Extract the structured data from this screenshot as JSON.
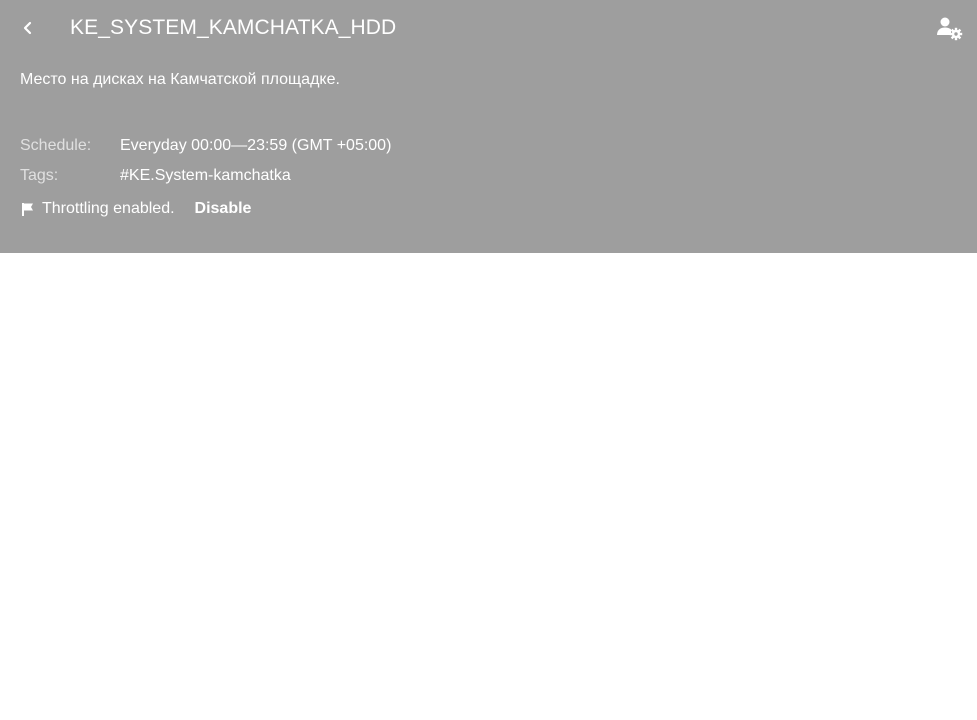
{
  "header": {
    "title": "KE_SYSTEM_KAMCHATKA_HDD",
    "back_icon": "chevron-left-icon",
    "settings_icon": "user-settings-icon"
  },
  "description": "Место на дисках на Камчатской площадке.",
  "meta": {
    "schedule_label": "Schedule:",
    "schedule_value": "Everyday 00:00—23:59 (GMT +05:00)",
    "tags_label": "Tags:",
    "tags_value": "#KE.System-kamchatka"
  },
  "throttling": {
    "icon": "flag-icon",
    "status_text": "Throttling enabled.",
    "action_label": "Disable"
  },
  "colors": {
    "panel_background": "#9e9e9e",
    "text": "#ffffff",
    "label_text": "#e0e0e0"
  }
}
